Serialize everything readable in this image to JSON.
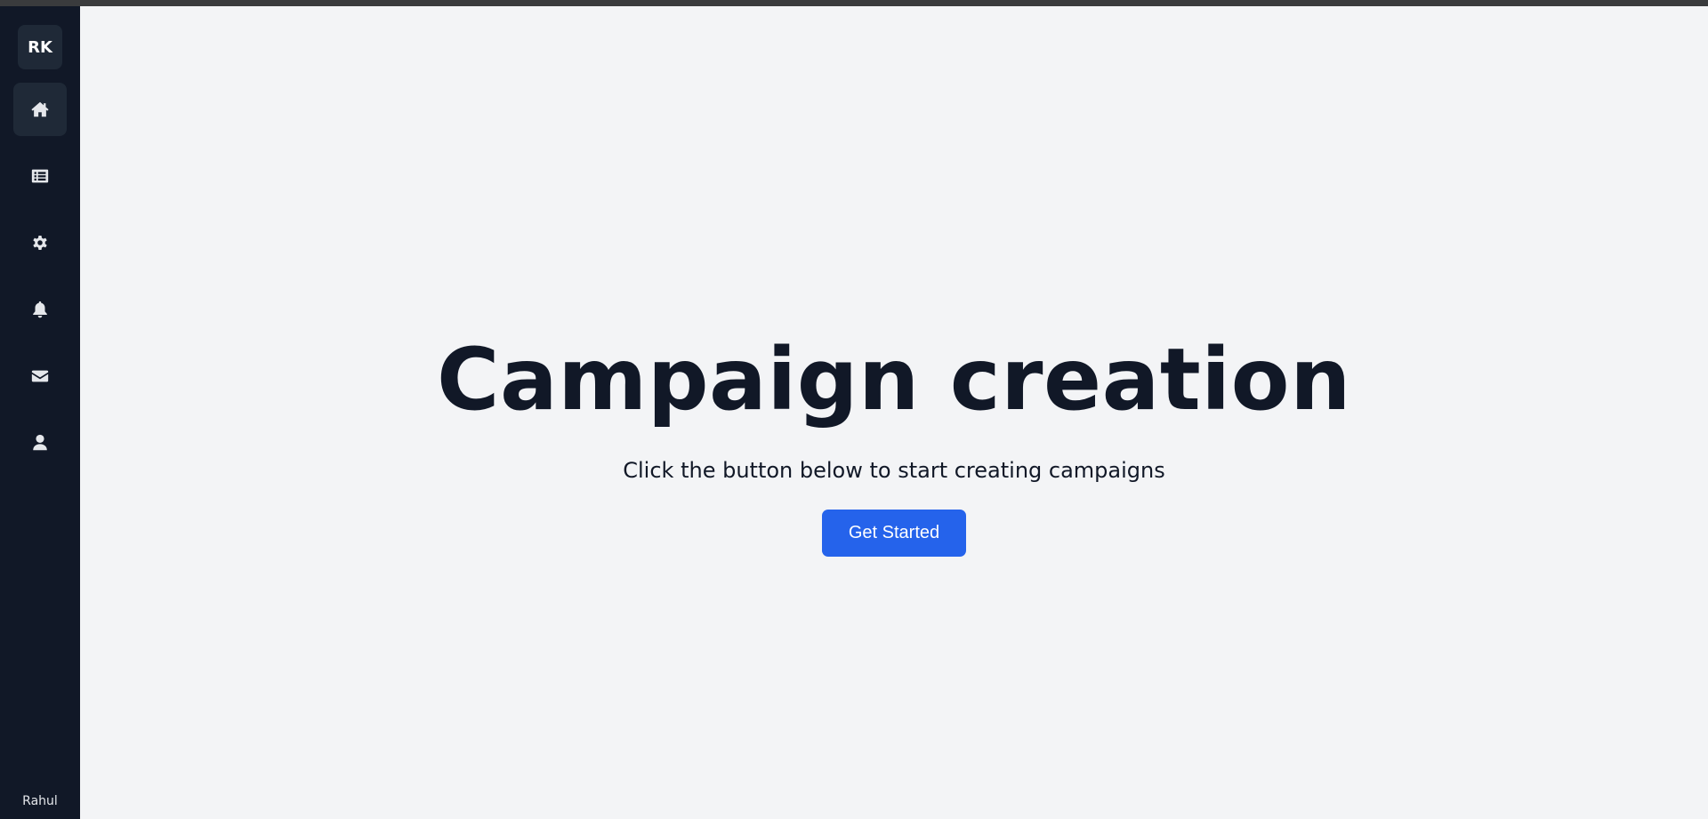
{
  "sidebar": {
    "avatar_initials": "RK",
    "items": [
      {
        "icon": "home-icon",
        "active": true
      },
      {
        "icon": "list-icon",
        "active": false
      },
      {
        "icon": "gear-icon",
        "active": false
      },
      {
        "icon": "bell-icon",
        "active": false
      },
      {
        "icon": "envelope-icon",
        "active": false
      },
      {
        "icon": "user-icon",
        "active": false
      }
    ],
    "user_name": "Rahul"
  },
  "main": {
    "title": "Campaign creation",
    "subtitle": "Click the button below to start creating campaigns",
    "cta_label": "Get Started"
  },
  "colors": {
    "sidebar_bg": "#111827",
    "main_bg": "#f3f4f6",
    "accent": "#2563eb",
    "text": "#111827"
  }
}
